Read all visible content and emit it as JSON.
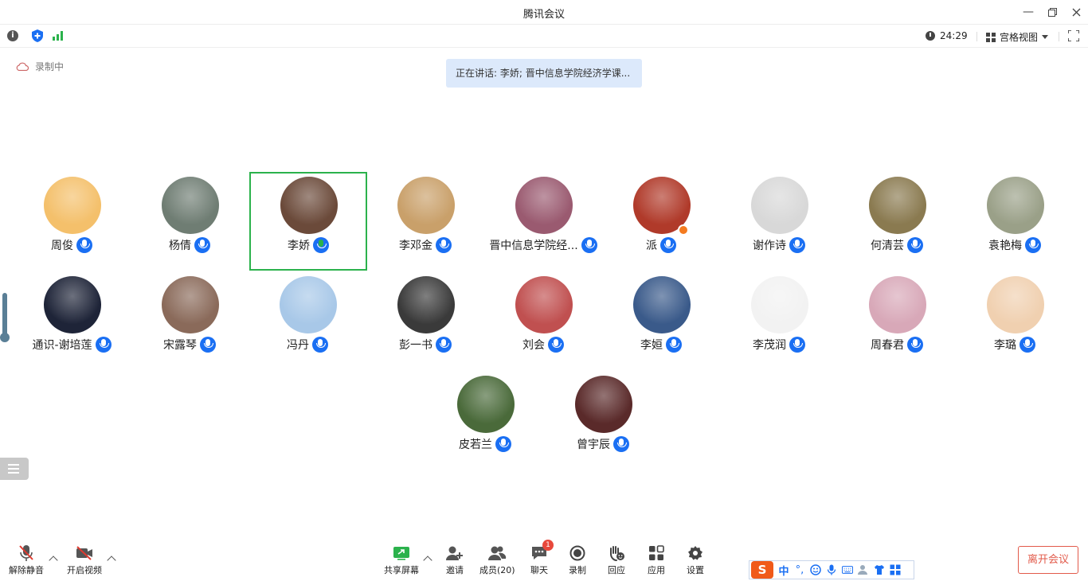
{
  "window": {
    "title": "腾讯会议"
  },
  "infobar": {
    "timer": "24:29",
    "view_mode": "宫格视图"
  },
  "recording": {
    "label": "录制中"
  },
  "speaking": {
    "text": "正在讲话: 李娇; 晋中信息学院经济学课..."
  },
  "participants": [
    {
      "name": "周俊",
      "mic": "on",
      "avatar_color": "#f4c06b"
    },
    {
      "name": "杨倩",
      "mic": "on",
      "avatar_color": "#6f7d73"
    },
    {
      "name": "李娇",
      "mic": "speaking",
      "avatar_color": "#6b4a3a"
    },
    {
      "name": "李邓金",
      "mic": "on",
      "avatar_color": "#c9a06a"
    },
    {
      "name": "晋中信息学院经...",
      "mic": "on",
      "avatar_color": "#9a5a70"
    },
    {
      "name": "派",
      "mic": "on",
      "avatar_color": "#b03a2a"
    },
    {
      "name": "谢作诗",
      "mic": "on",
      "avatar_color": "#d8d8d8"
    },
    {
      "name": "何清芸",
      "mic": "on",
      "avatar_color": "#8a7a50"
    },
    {
      "name": "袁艳梅",
      "mic": "on",
      "avatar_color": "#9aa088"
    },
    {
      "name": "通识-谢培莲",
      "mic": "on",
      "avatar_color": "#1e2438"
    },
    {
      "name": "宋露琴",
      "mic": "on",
      "avatar_color": "#8a6a5a"
    },
    {
      "name": "冯丹",
      "mic": "on",
      "avatar_color": "#a8c8e8"
    },
    {
      "name": "彭一书",
      "mic": "on",
      "avatar_color": "#3a3a3a"
    },
    {
      "name": "刘会",
      "mic": "on",
      "avatar_color": "#c05050"
    },
    {
      "name": "李姮",
      "mic": "on",
      "avatar_color": "#3a5a8a"
    },
    {
      "name": "李茂润",
      "mic": "on",
      "avatar_color": "#f2f2f2"
    },
    {
      "name": "周春君",
      "mic": "on",
      "avatar_color": "#d8a8b8"
    },
    {
      "name": "李璐",
      "mic": "on",
      "avatar_color": "#f0d0b0"
    },
    {
      "name": "皮若兰",
      "mic": "on",
      "avatar_color": "#4a6a3a"
    },
    {
      "name": "曾宇辰",
      "mic": "on",
      "avatar_color": "#5a2a2a"
    }
  ],
  "toolbar": {
    "unmute": "解除静音",
    "start_video": "开启视频",
    "share_screen": "共享屏幕",
    "invite": "邀请",
    "members": "成员(20)",
    "chat": "聊天",
    "chat_badge": "1",
    "record": "录制",
    "react": "回应",
    "apps": "应用",
    "settings": "设置",
    "leave": "离开会议"
  },
  "ime": {
    "logo": "S",
    "mode": "中",
    "punct": "°,"
  },
  "colors": {
    "accent": "#1a6ff3",
    "speaking_border": "#2bb24c",
    "leave": "#e25a4a"
  }
}
